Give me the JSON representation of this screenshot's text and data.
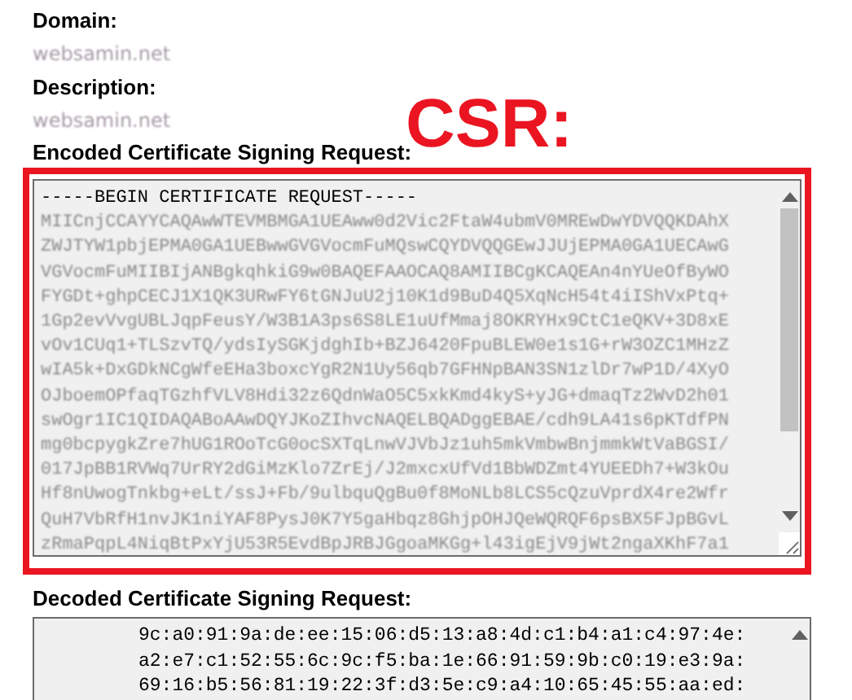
{
  "fields": [
    {
      "label": "Domain:",
      "value": "websamin.net"
    },
    {
      "label": "Description:",
      "value": "websamin.net"
    }
  ],
  "annotation": {
    "text": "CSR:"
  },
  "encoded": {
    "label": "Encoded Certificate Signing Request:",
    "lines": [
      "-----BEGIN CERTIFICATE REQUEST-----",
      "MIICnjCCAYYCAQAwWTEVMBMGA1UEAww0d2Vic2FtaW4ubmV0MREwDwYDVQQKDAhX",
      "ZWJTYW1pbjEPMA0GA1UEBwwGVGVocmFuMQswCQYDVQQGEwJJUjEPMA0GA1UECAwG",
      "VGVocmFuMIIBIjANBgkqhkiG9w0BAQEFAAOCAQ8AMIIBCgKCAQEAn4nYUeOfByWO",
      "FYGDt+ghpCECJ1X1QK3URwFY6tGNJuU2j10K1d9BuD4Q5XqNcH54t4iIShVxPtq+",
      "1Gp2evVvgUBLJqpFeusY/W3B1A3ps6S8LE1uUfMmaj8OKRYHx9CtC1eQKV+3D8xE",
      "vOv1CUq1+TLSzvTQ/ydsIySGKjdghIb+BZJ6420FpuBLEW0e1s1G+rW3OZC1MHzZ",
      "wIA5k+DxGDkNCgWfeEHa3boxcYgR2N1Uy56qb7GFHNpBAN3SN1zlDr7wP1D/4XyO",
      "OJboemOPfaqTGzhfVLV8Hdi32z6QdnWaO5C5xkKmd4kyS+yJG+dmaqTz2WvD2h01",
      "swOgr1IC1QIDAQABoAAwDQYJKoZIhvcNAQELBQADggEBAE/cdh9LA41s6pKTdfPN",
      "mg0bcpygkZre7hUG1ROoTcG0ocSXTqLnwVJVbJz1uh5mkVmbwBnjmmkWtVaBGSI/",
      "017JpBB1RVWq7UrRY2dGiMzKlo7ZrEj/J2mxcxUfVd1BbWDZmt4YUEEDh7+W3kOu",
      "Hf8nUwogTnkbg+eLt/ssJ+Fb/9ulbquQgBu0f8MoNLb8LCS5cQzuVprdX4re2Wfr",
      "QuH7VbRfH1nvJK1niYAF8PysJ0K7Y5gaHbqz8GhjpOHJQeWQRQF6psBX5FJpBGvL",
      "zRmaPqpL4NiqBtPxYjU53R5EvdBpJRBJGgoaMKGg+l43igEjV9jWt2ngaXKhF7a1"
    ]
  },
  "decoded": {
    "label": "Decoded Certificate Signing Request:",
    "lines": [
      "9c:a0:91:9a:de:ee:15:06:d5:13:a8:4d:c1:b4:a1:c4:97:4e:",
      "a2:e7:c1:52:55:6c:9c:f5:ba:1e:66:91:59:9b:c0:19:e3:9a:",
      "69:16:b5:56:81:19:22:3f:d3:5e:c9:a4:10:65:45:55:aa:ed:"
    ]
  }
}
